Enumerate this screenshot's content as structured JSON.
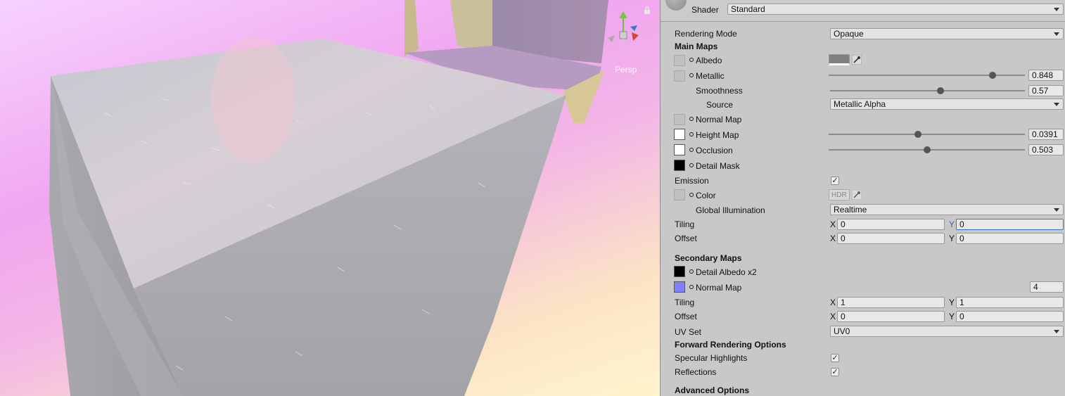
{
  "scene": {
    "persp_label": "Persp"
  },
  "header": {
    "shader_label": "Shader",
    "shader_value": "Standard"
  },
  "rendering_mode": {
    "label": "Rendering Mode",
    "value": "Opaque"
  },
  "main_maps": {
    "title": "Main Maps",
    "albedo": {
      "label": "Albedo",
      "color": "#808080"
    },
    "metallic": {
      "label": "Metallic",
      "value": "0.848",
      "fraction": 0.848
    },
    "smoothness": {
      "label": "Smoothness",
      "value": "0.57",
      "fraction": 0.57
    },
    "source": {
      "label": "Source",
      "value": "Metallic Alpha"
    },
    "normal_map": {
      "label": "Normal Map"
    },
    "height_map": {
      "label": "Height Map",
      "value": "0.0391",
      "fraction": 0.463
    },
    "occlusion": {
      "label": "Occlusion",
      "value": "0.503",
      "fraction": 0.503
    },
    "detail_mask": {
      "label": "Detail Mask"
    },
    "emission": {
      "label": "Emission",
      "checked": "✓"
    },
    "color": {
      "label": "Color",
      "hdr": "HDR"
    },
    "global_illumination": {
      "label": "Global Illumination",
      "value": "Realtime"
    },
    "tiling": {
      "label": "Tiling",
      "x_axis": "X",
      "x": "0",
      "y_axis": "Y",
      "y": "0"
    },
    "offset": {
      "label": "Offset",
      "x_axis": "X",
      "x": "0",
      "y_axis": "Y",
      "y": "0"
    }
  },
  "secondary_maps": {
    "title": "Secondary Maps",
    "detail_albedo": {
      "label": "Detail Albedo x2"
    },
    "normal_map": {
      "label": "Normal Map",
      "value": "4"
    },
    "tiling": {
      "label": "Tiling",
      "x_axis": "X",
      "x": "1",
      "y_axis": "Y",
      "y": "1"
    },
    "offset": {
      "label": "Offset",
      "x_axis": "X",
      "x": "0",
      "y_axis": "Y",
      "y": "0"
    },
    "uv_set": {
      "label": "UV Set",
      "value": "UV0"
    }
  },
  "forward_rendering": {
    "title": "Forward Rendering Options",
    "specular_highlights": {
      "label": "Specular Highlights",
      "checked": "✓"
    },
    "reflections": {
      "label": "Reflections",
      "checked": "✓"
    }
  },
  "advanced": {
    "title": "Advanced Options"
  }
}
